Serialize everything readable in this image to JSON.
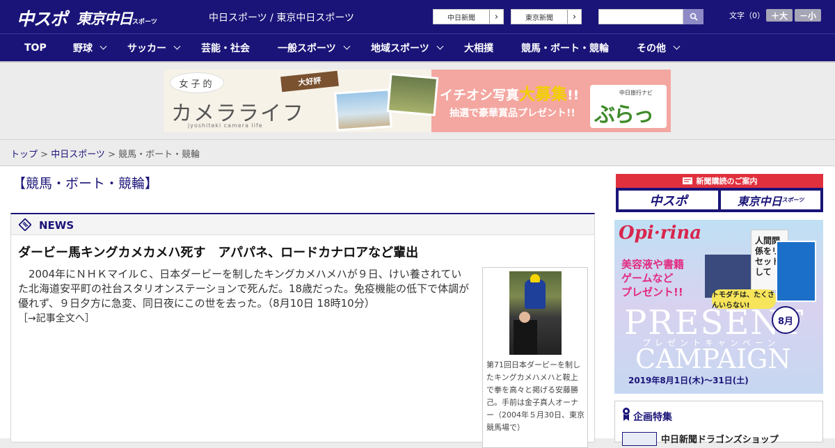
{
  "header": {
    "logo_main": "中スポ",
    "logo_sub": "東京中日",
    "logo_sub_small": "スポーツ",
    "site_title": "中日スポーツ / 東京中日スポーツ",
    "ext_links": [
      {
        "label": "中日新聞"
      },
      {
        "label": "東京新聞"
      }
    ],
    "search": {
      "value": "",
      "placeholder": ""
    },
    "font_size_label": "文字（0）",
    "font_plus_label": "＋大",
    "font_minus_label": "－小"
  },
  "nav": {
    "items": [
      {
        "label": "TOP"
      },
      {
        "label": "野球"
      },
      {
        "label": "サッカー"
      },
      {
        "label": "芸能・社会"
      },
      {
        "label": "一般スポーツ"
      },
      {
        "label": "地域スポーツ"
      },
      {
        "label": "大相撲"
      },
      {
        "label": "競馬・ボート・競輪"
      },
      {
        "label": "その他"
      }
    ]
  },
  "banner": {
    "bubble": "女子的",
    "title": "カメラライフ",
    "roman": "jyoshiteki camera life",
    "tag": "大好評",
    "headline_pre": "イチオシ写真",
    "headline_big": "大募集",
    "headline_post": "!!",
    "prize": "抽選で豪華賞品プレゼント!!",
    "brand_small": "中日旅行ナビ",
    "brand": "ぶらっ人"
  },
  "breadcrumb": {
    "home": "トップ",
    "sep": " > ",
    "section": "中日スポーツ",
    "current": "競馬・ボート・競輪"
  },
  "page_title": "【競馬・ボート・競輪】",
  "news": {
    "label": "NEWS",
    "headline": "ダービー馬キングカメカメハ死す　アパパネ、ロードカナロアなど輩出",
    "body": "2004年にＮＨＫマイルＣ、日本ダービーを制したキングカメハメハが９日、けい養されていた北海道安平町の社台スタリオンステーションで死んだ。18歳だった。免疫機能の低下で体調が優れず、９日夕方に急変、同日夜にこの世を去った。（8月10日 18時10分）",
    "more": "［→記事全文へ］",
    "caption": "第71回日本ダービーを制したキングカメハメハと鞍上で拳を高々と掲げる安藤勝己。手前は金子真人オーナー（2004年５月30日、東京競馬場で）"
  },
  "sidebar": {
    "subscribe_head": "新聞購読のご案内",
    "sub_btn_1": "中スポ",
    "sub_btn_2": "東京中日",
    "sub_btn_2_small": "スポーツ",
    "ad": {
      "brand": "Opi·rina",
      "pink_1": "美容液や書籍",
      "pink_2": "ゲームなど",
      "pink_3": "プレゼント!!",
      "book": "人間関係をリセットして",
      "speech": "トモダチは、たくさんいらない!",
      "present": "PRESENT",
      "month": "8月",
      "kana": "プレゼントキャンペーン",
      "campaign": "CAMPAIGN",
      "dates": "2019年8月1日(木)～31日(土)"
    },
    "kikaku_title": "企画特集",
    "kikaku_item": "中日新聞ドラゴンズショップ"
  },
  "colors": {
    "brand_navy": "#1a1478",
    "subscribe_red": "#e0303e",
    "link": "#1a1478"
  }
}
